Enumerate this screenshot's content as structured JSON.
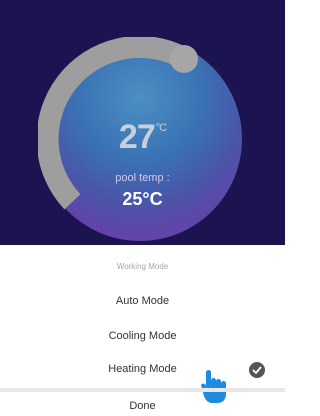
{
  "thermostat": {
    "set_temp": "27",
    "unit": "°C",
    "pool_label": "pool temp :",
    "pool_value": "25°C"
  },
  "mode_sheet": {
    "title": "Working Mode",
    "options": [
      {
        "label": "Auto Mode",
        "selected": false
      },
      {
        "label": "Cooling Mode",
        "selected": false
      },
      {
        "label": "Heating Mode",
        "selected": true
      }
    ],
    "done_label": "Done"
  },
  "icons": {
    "selected_check": "check-circle-icon",
    "pointer": "hand-pointer-icon"
  },
  "colors": {
    "header_bg": "#1b1450",
    "arc": "#9e9e9e",
    "hand": "#1e8be0",
    "check_bg": "#555555"
  }
}
